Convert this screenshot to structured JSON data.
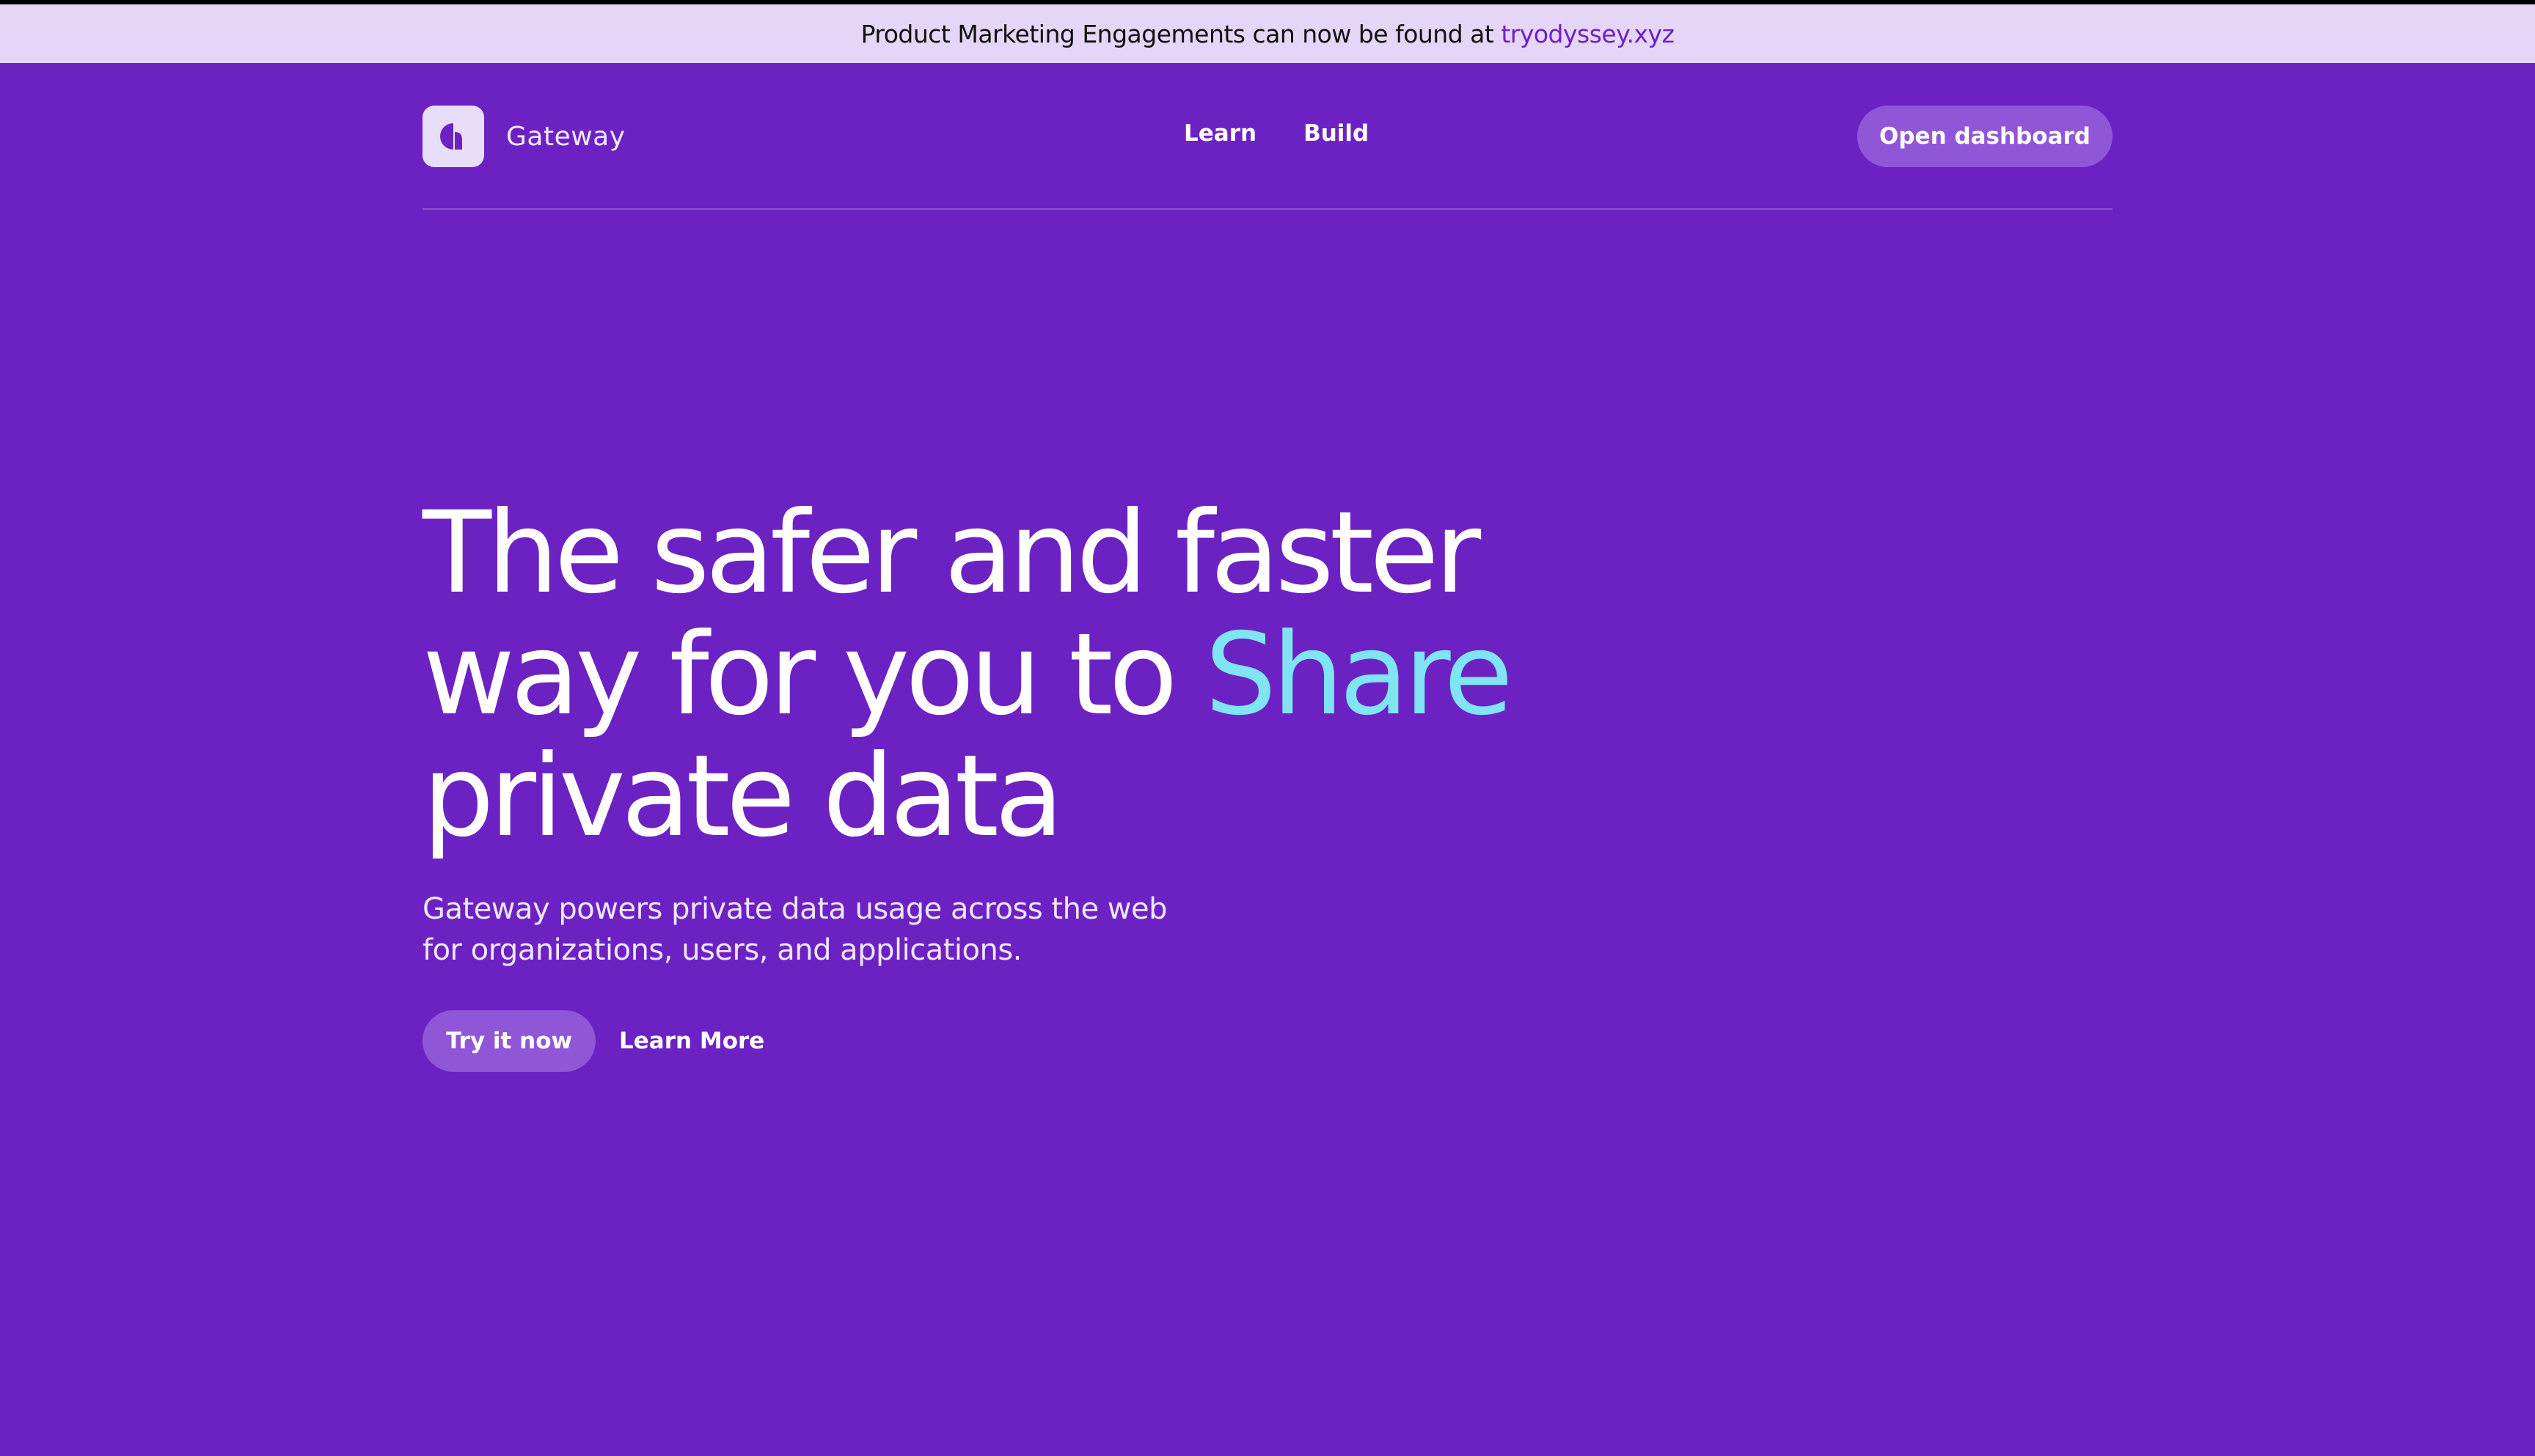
{
  "announcement": {
    "text": "Product Marketing Engagements can now be found at",
    "link_text": "tryodyssey.xyz"
  },
  "header": {
    "logo_icon": "gateway-logo-icon",
    "brand_name": "Gateway",
    "nav": [
      {
        "label": "Learn"
      },
      {
        "label": "Build"
      }
    ],
    "dashboard_button": "Open dashboard"
  },
  "hero": {
    "headline_line1": "The safer and faster",
    "headline_line2_prefix": "way for you to",
    "headline_accent": "Share",
    "headline_line3": "private data",
    "subtitle_line1": "Gateway powers private data usage across the web",
    "subtitle_line2": "for organizations, users, and applications.",
    "primary_cta": "Try it now",
    "secondary_cta": "Learn More"
  },
  "colors": {
    "background": "#6c22c3",
    "announcement_bg": "#e5d5f6",
    "button_bg": "#9056d8",
    "accent": "#7fe4f4"
  }
}
